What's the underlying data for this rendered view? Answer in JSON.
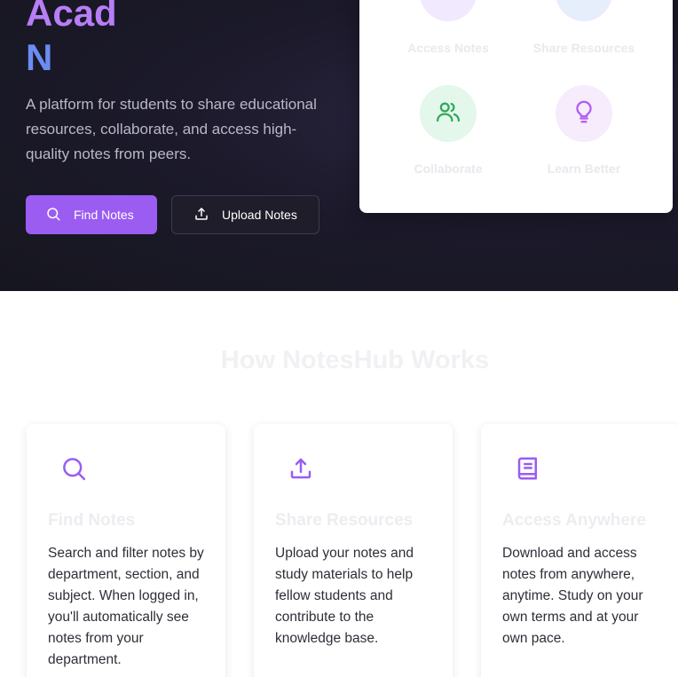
{
  "hero": {
    "title_line1": "Acad",
    "title_line2": "N",
    "description": "A platform for students to share educational resources, collaborate, and access high-quality notes from peers.",
    "find_button_label": "Find Notes",
    "upload_button_label": "Upload Notes"
  },
  "features": [
    {
      "label": "Access Notes",
      "icon": "chat-icon",
      "color": "#9b5cf2"
    },
    {
      "label": "Share Resources",
      "icon": "folder-icon",
      "color": "#4a7ef0"
    },
    {
      "label": "Collaborate",
      "icon": "users-icon",
      "color": "#2fa85a"
    },
    {
      "label": "Learn Better",
      "icon": "lightbulb-icon",
      "color": "#b25cf2"
    }
  ],
  "how_it_works": {
    "title": "How NotesHub Works",
    "cards": [
      {
        "title": "Find Notes",
        "icon": "search-icon",
        "description": "Search and filter notes by department, section, and subject. When logged in, you'll automatically see notes from your department."
      },
      {
        "title": "Share Resources",
        "icon": "upload-icon",
        "description": "Upload your notes and study materials to help fellow students and contribute to the knowledge base."
      },
      {
        "title": "Access Anywhere",
        "icon": "book-icon",
        "description": "Download and access notes from anywhere, anytime. Study on your own terms and at your own pace."
      }
    ]
  },
  "colors": {
    "accent": "#9b5cf2",
    "hero_bg": "#1c1a2b"
  }
}
